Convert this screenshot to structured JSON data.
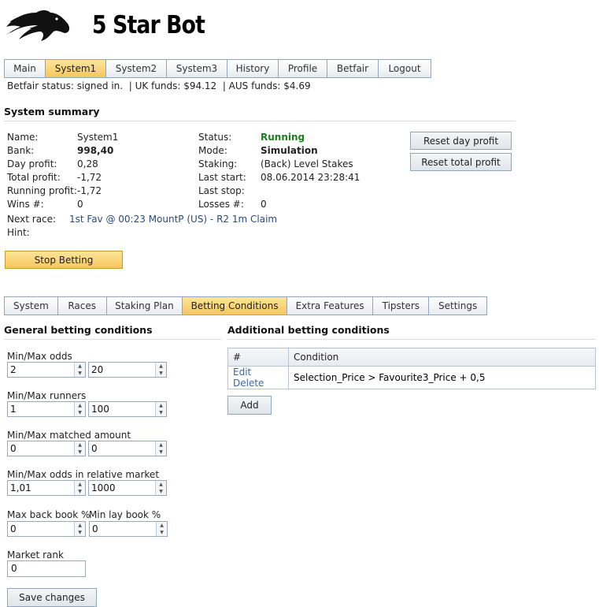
{
  "app": {
    "title": "5 Star Bot",
    "logo_icon": "horse-head-logo",
    "accent_color": "#f6c75c"
  },
  "main_tabs": [
    {
      "label": "Main"
    },
    {
      "label": "System1",
      "active": true
    },
    {
      "label": "System2"
    },
    {
      "label": "System3"
    },
    {
      "label": "History"
    },
    {
      "label": "Profile"
    },
    {
      "label": "Betfair"
    },
    {
      "label": "Logout"
    }
  ],
  "status_line": "Betfair status: signed in.  | UK funds: $94.12  | AUS funds: $4.69",
  "summary": {
    "title": "System summary",
    "left": [
      {
        "label": "Name:",
        "value": "System1"
      },
      {
        "label": "Bank:",
        "value": "998,40"
      },
      {
        "label": "Day profit:",
        "value": "0,28"
      },
      {
        "label": "Total profit:",
        "value": "-1,72"
      },
      {
        "label": "Running profit:",
        "value": "-1,72"
      },
      {
        "label": "Wins #:",
        "value": "0"
      }
    ],
    "right": [
      {
        "label": "Status:",
        "value": "Running"
      },
      {
        "label": "Mode:",
        "value": "Simulation"
      },
      {
        "label": "Staking:",
        "value": "(Back) Level Stakes"
      },
      {
        "label": "Last start:",
        "value": "08.06.2014 23:28:41"
      },
      {
        "label": "Last stop:",
        "value": ""
      },
      {
        "label": "Losses #:",
        "value": "0"
      }
    ],
    "next_race_label": "Next race:",
    "next_race_value": "1st Fav @ 00:23 MountP (US) - R2 1m Claim",
    "hint_label": "Hint:",
    "hint_value": "",
    "reset_day_label": "Reset day profit",
    "reset_total_label": "Reset total profit",
    "stop_betting_label": "Stop Betting",
    "status_color": "#1e7d1e"
  },
  "sub_tabs": [
    {
      "label": "System"
    },
    {
      "label": "Races"
    },
    {
      "label": "Staking Plan"
    },
    {
      "label": "Betting Conditions",
      "active": true
    },
    {
      "label": "Extra Features"
    },
    {
      "label": "Tipsters"
    },
    {
      "label": "Settings"
    }
  ],
  "general": {
    "title": "General betting conditions",
    "odds_label": "Min/Max odds",
    "odds_min": "2",
    "odds_max": "20",
    "runners_label": "Min/Max runners",
    "runners_min": "1",
    "runners_max": "100",
    "matched_label": "Min/Max matched amount",
    "matched_min": "0",
    "matched_max": "0",
    "rel_label": "Min/Max odds in relative market",
    "rel_min": "1,01",
    "rel_max": "1000",
    "back_book_label": "Max back book %",
    "lay_book_label": "Min lay book %",
    "back_book_value": "0",
    "lay_book_value": "0",
    "market_rank_label": "Market rank",
    "market_rank_value": "0",
    "save_label": "Save changes"
  },
  "additional": {
    "title": "Additional betting conditions",
    "col_hash": "#",
    "col_condition": "Condition",
    "rows": [
      {
        "edit": "Edit",
        "delete": "Delete",
        "condition": "Selection_Price > Favourite3_Price + 0,5"
      }
    ],
    "add_label": "Add"
  }
}
